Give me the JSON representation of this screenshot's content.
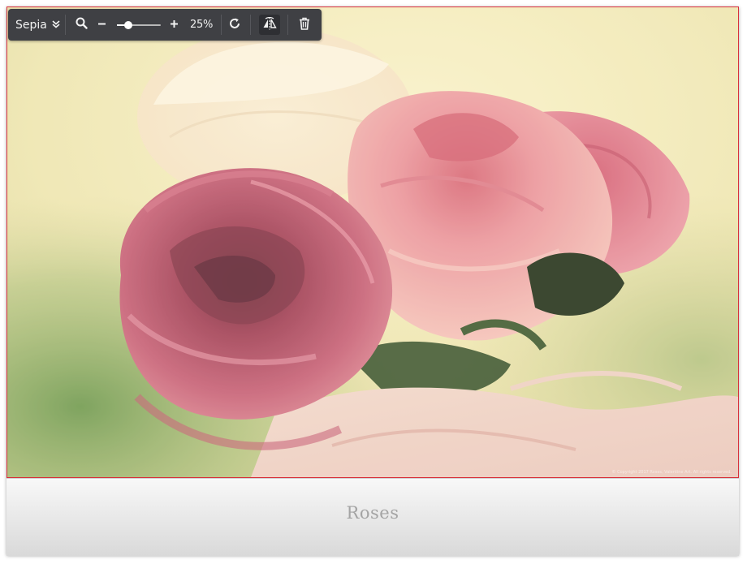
{
  "toolbar": {
    "filter_label": "Sepia",
    "zoom_text": "25%",
    "zoom_level": 0.25,
    "colors": {
      "background": "#3f4044",
      "text": "#f2f2f2"
    },
    "icons": {
      "filter_dropdown": "chevron-double-down-icon",
      "magnifier": "magnifier-icon",
      "zoom_out": "minus-icon",
      "zoom_in": "plus-icon",
      "rotate": "rotate-icon",
      "flip": "flip-horizontal-icon",
      "delete": "trash-icon"
    }
  },
  "photo": {
    "subject": "roses",
    "frame_color": "#d8303a"
  },
  "caption": {
    "text": "Roses"
  },
  "watermark": {
    "text": "© Copyright 2017 Roses, Valentine Art. All rights reserved."
  }
}
